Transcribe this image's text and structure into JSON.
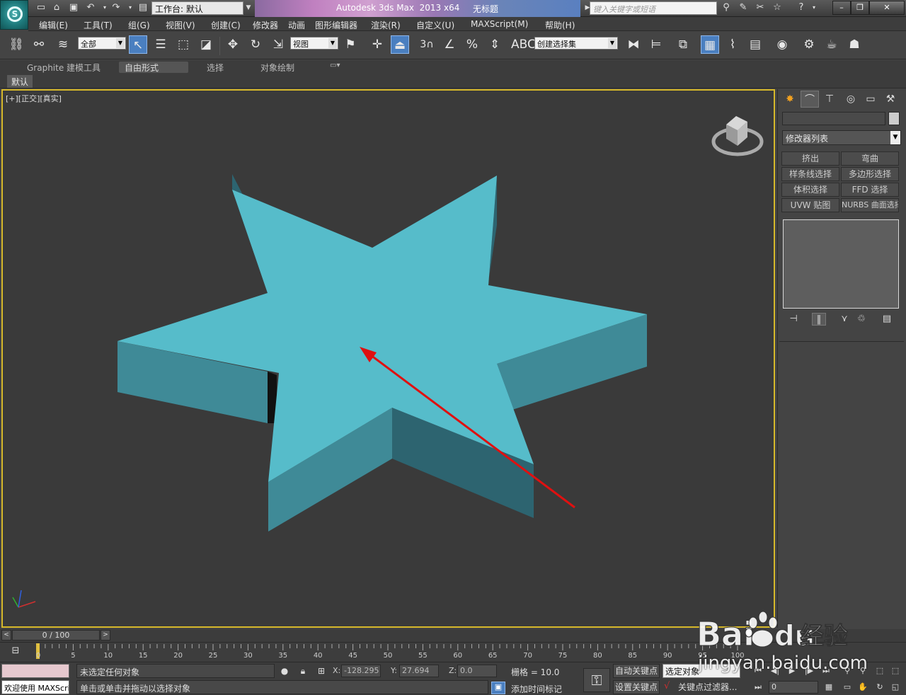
{
  "titlebar": {
    "workspace_label": "工作台: 默认",
    "app_title": "Autodesk 3ds Max  2013 x64",
    "doc_title": "无标题",
    "search_placeholder": "键入关键字或短语"
  },
  "menu": [
    "编辑(E)",
    "工具(T)",
    "组(G)",
    "视图(V)",
    "创建(C)",
    "修改器",
    "动画",
    "图形编辑器",
    "渲染(R)",
    "自定义(U)",
    "MAXScript(M)",
    "帮助(H)"
  ],
  "toolbar": {
    "selection_filter": "全部",
    "ref_coord": "视图",
    "named_selection": "创建选择集",
    "snap_angle_label": "3"
  },
  "ribbon": {
    "tabs": [
      "Graphite 建模工具",
      "自由形式",
      "选择",
      "对象绘制"
    ],
    "active_tab": "自由形式",
    "sub_tab": "默认"
  },
  "viewport": {
    "label": "[+][正交][真实]",
    "object_color": "#56bcca",
    "side_color_dark": "#2d6470",
    "side_color_mid": "#3f8a97",
    "arrow_color": "#e01010",
    "border_color": "#d6b82a"
  },
  "command_panel": {
    "modifier_list": "修改器列表",
    "buttons": [
      "挤出",
      "弯曲",
      "样条线选择",
      "多边形选择",
      "体积选择",
      "FFD 选择",
      "UVW 贴图",
      "NURBS 曲面选择"
    ]
  },
  "timeslider": {
    "position": "0 / 100",
    "ticks": [
      "0",
      "5",
      "10",
      "15",
      "20",
      "25",
      "30",
      "35",
      "40",
      "45",
      "50",
      "55",
      "60",
      "65",
      "70",
      "75",
      "80",
      "85",
      "90",
      "95",
      "100"
    ]
  },
  "status": {
    "maxscript_welcome": "欢迎使用 MAXScri",
    "selection": "未选定任何对象",
    "prompt": "单击或单击并拖动以选择对象",
    "x_label": "X:",
    "x": "-128.295",
    "y_label": "Y:",
    "y": "27.694",
    "z_label": "Z:",
    "z": "0.0",
    "grid": "栅格 = 10.0",
    "add_time_tag": "添加时间标记",
    "auto_key": "自动关键点",
    "set_key": "设置关键点",
    "selected_object": "选定对象",
    "key_filters": "关键点过滤器...",
    "frame": "0"
  },
  "watermark": {
    "brand": "Bai",
    "brand_suffix": "du",
    "brand_cn": "经验",
    "url": "jingyan.baidu.com"
  }
}
